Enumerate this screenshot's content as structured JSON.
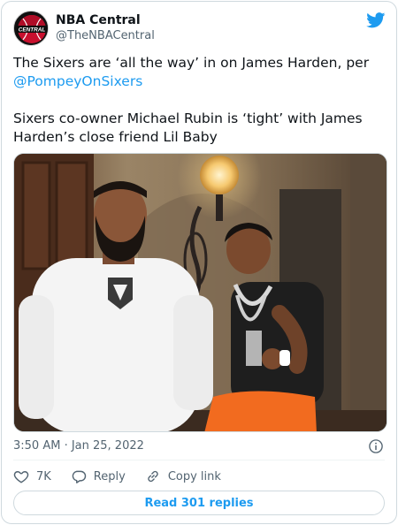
{
  "user": {
    "display_name": "NBA Central",
    "handle": "@TheNBACentral",
    "avatar_text": "CENTRAL"
  },
  "tweet": {
    "line1": "The Sixers are ‘all the way’ in on James Harden, per",
    "mention": "@PompeyOnSixers",
    "line2": "Sixers co-owner Michael Rubin is ‘tight’ with James Harden’s close friend Lil Baby"
  },
  "timestamp": "3:50 AM · Jan 25, 2022",
  "actions": {
    "like_count": "7K",
    "reply_label": "Reply",
    "copy_label": "Copy link"
  },
  "read_replies_label": "Read 301 replies",
  "colors": {
    "accent": "#1d9bf0",
    "like": "#f91880",
    "secondary_text": "#536471"
  },
  "icons": {
    "bird": "twitter-bird-icon",
    "info": "info-icon",
    "like": "heart-icon",
    "reply": "reply-bubble-icon",
    "copy": "link-icon"
  }
}
